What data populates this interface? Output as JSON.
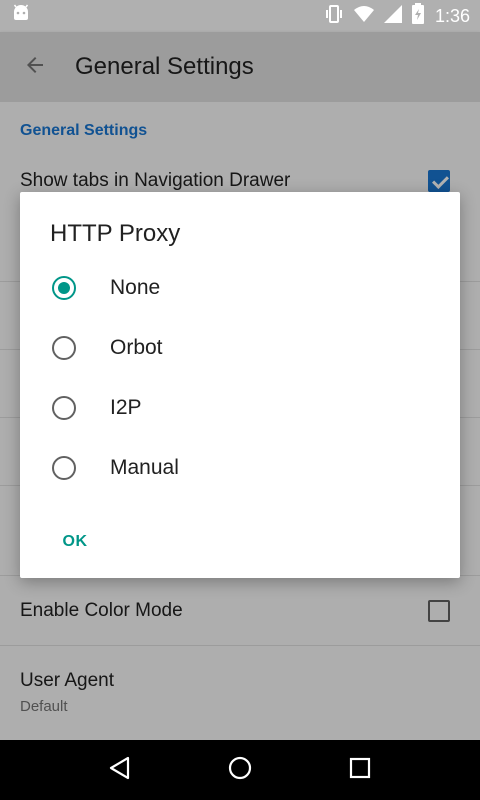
{
  "status_bar": {
    "time": "1:36",
    "icons": [
      "android-icon",
      "vibrate-icon",
      "wifi-icon",
      "signal-icon",
      "battery-icon"
    ]
  },
  "toolbar": {
    "back_icon": "arrow-left-icon",
    "title": "General Settings"
  },
  "settings": {
    "section_header": "General Settings",
    "items": [
      {
        "title": "Show tabs in Navigation Drawer",
        "checked": true
      },
      {
        "title": "Enable Color Mode",
        "checked": false
      },
      {
        "title": "User Agent",
        "summary": "Default"
      }
    ]
  },
  "dialog": {
    "title": "HTTP Proxy",
    "options": [
      {
        "label": "None",
        "selected": true
      },
      {
        "label": "Orbot",
        "selected": false
      },
      {
        "label": "I2P",
        "selected": false
      },
      {
        "label": "Manual",
        "selected": false
      }
    ],
    "ok_label": "OK"
  },
  "nav_bar": {
    "buttons": [
      "back-icon",
      "home-icon",
      "recents-icon"
    ]
  },
  "colors": {
    "accent": "#009688",
    "primary": "#1976d2"
  }
}
